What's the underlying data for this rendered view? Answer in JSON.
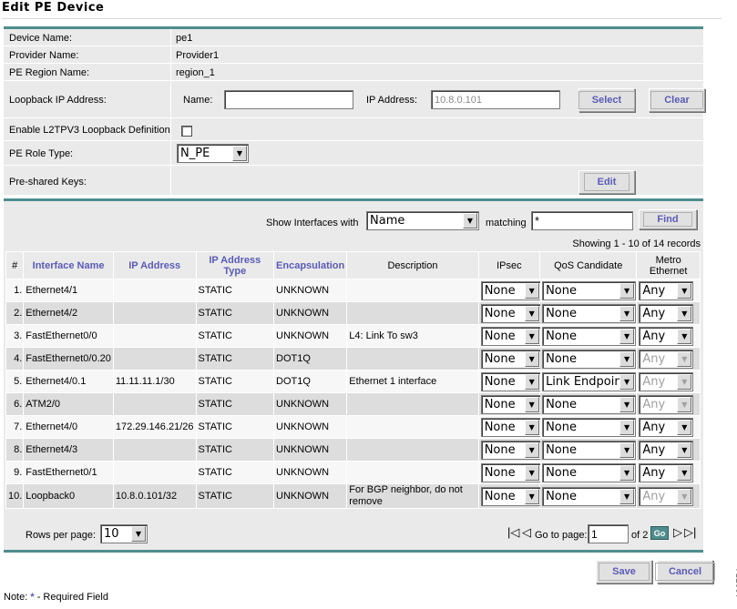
{
  "page": {
    "title": "Edit PE Device",
    "side_id": "138754"
  },
  "form": {
    "device_name_label": "Device Name:",
    "device_name_value": "pe1",
    "provider_name_label": "Provider Name:",
    "provider_name_value": "Provider1",
    "region_label": "PE Region Name:",
    "region_value": "region_1",
    "loopback_label": "Loopback IP Address:",
    "loopback_name_label": "Name:",
    "loopback_name_value": "",
    "loopback_ip_label": "IP Address:",
    "loopback_ip_value": "10.8.0.101",
    "select_button": "Select",
    "clear_button": "Clear",
    "l2tpv3_label": "Enable L2TPV3 Loopback Definition",
    "role_label": "PE Role Type:",
    "role_value": "N_PE",
    "psk_label": "Pre-shared Keys:",
    "edit_button": "Edit"
  },
  "filter": {
    "show_label": "Show Interfaces with",
    "field_value": "Name",
    "matching_label": "matching",
    "matching_value": "*",
    "find_button": "Find",
    "records": "Showing 1 - 10 of 14 records"
  },
  "table": {
    "headers": {
      "num": "#",
      "interface_name": "Interface Name",
      "ip_address": "IP Address",
      "ip_type_1": "IP Address",
      "ip_type_2": "Type",
      "encapsulation": "Encapsulation",
      "description": "Description",
      "ipsec": "IPsec",
      "qos": "QoS Candidate",
      "metro_1": "Metro",
      "metro_2": "Ethernet"
    },
    "rows": [
      {
        "num": "1.",
        "name": "Ethernet4/1",
        "ip": "",
        "type": "STATIC",
        "encap": "UNKNOWN",
        "desc": "",
        "desc2": "",
        "ipsec": "None",
        "qos": "None",
        "metro": "Any",
        "metro_disabled": false
      },
      {
        "num": "2.",
        "name": "Ethernet4/2",
        "ip": "",
        "type": "STATIC",
        "encap": "UNKNOWN",
        "desc": "",
        "desc2": "",
        "ipsec": "None",
        "qos": "None",
        "metro": "Any",
        "metro_disabled": false
      },
      {
        "num": "3.",
        "name": "FastEthernet0/0",
        "ip": "",
        "type": "STATIC",
        "encap": "UNKNOWN",
        "desc": "L4: Link To sw3",
        "desc2": "",
        "ipsec": "None",
        "qos": "None",
        "metro": "Any",
        "metro_disabled": false
      },
      {
        "num": "4.",
        "name": "FastEthernet0/0.20",
        "ip": "",
        "type": "STATIC",
        "encap": "DOT1Q",
        "desc": "",
        "desc2": "",
        "ipsec": "None",
        "qos": "None",
        "metro": "Any",
        "metro_disabled": true
      },
      {
        "num": "5.",
        "name": "Ethernet4/0.1",
        "ip": "11.11.11.1/30",
        "type": "STATIC",
        "encap": "DOT1Q",
        "desc": "Ethernet 1 interface",
        "desc2": "",
        "ipsec": "None",
        "qos": "Link Endpoint",
        "metro": "Any",
        "metro_disabled": true
      },
      {
        "num": "6.",
        "name": "ATM2/0",
        "ip": "",
        "type": "STATIC",
        "encap": "UNKNOWN",
        "desc": "",
        "desc2": "",
        "ipsec": "None",
        "qos": "None",
        "metro": "Any",
        "metro_disabled": true
      },
      {
        "num": "7.",
        "name": "Ethernet4/0",
        "ip": "172.29.146.21/26",
        "type": "STATIC",
        "encap": "UNKNOWN",
        "desc": "",
        "desc2": "",
        "ipsec": "None",
        "qos": "None",
        "metro": "Any",
        "metro_disabled": false
      },
      {
        "num": "8.",
        "name": "Ethernet4/3",
        "ip": "",
        "type": "STATIC",
        "encap": "UNKNOWN",
        "desc": "",
        "desc2": "",
        "ipsec": "None",
        "qos": "None",
        "metro": "Any",
        "metro_disabled": false
      },
      {
        "num": "9.",
        "name": "FastEthernet0/1",
        "ip": "",
        "type": "STATIC",
        "encap": "UNKNOWN",
        "desc": "",
        "desc2": "",
        "ipsec": "None",
        "qos": "None",
        "metro": "Any",
        "metro_disabled": false
      },
      {
        "num": "10.",
        "name": "Loopback0",
        "ip": "10.8.0.101/32",
        "type": "STATIC",
        "encap": "UNKNOWN",
        "desc": "For BGP neighbor, do not",
        "desc2": "remove",
        "ipsec": "None",
        "qos": "None",
        "metro": "Any",
        "metro_disabled": true
      }
    ]
  },
  "pager": {
    "rows_label": "Rows per page:",
    "rows_value": "10",
    "goto_label": "Go to page:",
    "page_value": "1",
    "of_label": "of 2",
    "go_button": "Go"
  },
  "actions": {
    "save": "Save",
    "cancel": "Cancel"
  },
  "note": {
    "prefix": "Note:",
    "star": "*",
    "text": "- Required Field"
  }
}
